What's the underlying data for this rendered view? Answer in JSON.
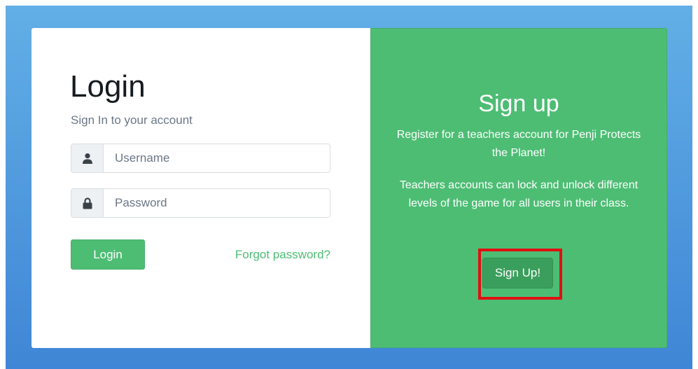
{
  "login": {
    "title": "Login",
    "subtitle": "Sign In to your account",
    "username_placeholder": "Username",
    "password_placeholder": "Password",
    "username_icon": "user-icon",
    "password_icon": "lock-icon",
    "login_button_label": "Login",
    "forgot_password_label": "Forgot password?"
  },
  "signup": {
    "title": "Sign up",
    "paragraph_1": "Register for a teachers account for Penji Protects the Planet!",
    "paragraph_2": "Teachers accounts can lock and unlock different levels of the game for all users in their class.",
    "button_label": "Sign Up!"
  },
  "colors": {
    "background_gradient_top": "#62afe6",
    "background_gradient_bottom": "#3f86d6",
    "accent_green": "#4dbd74",
    "signup_button": "#3a9f5c",
    "highlight_red": "#e00f12"
  }
}
